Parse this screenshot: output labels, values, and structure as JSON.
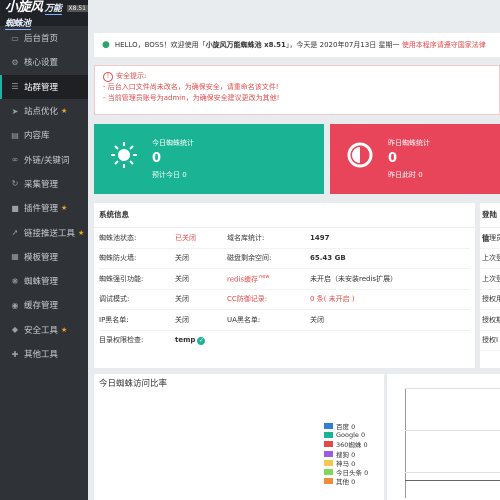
{
  "app": {
    "logo_main": "小旋风",
    "logo_sub": "万能蜘蛛池",
    "version": "X8.51"
  },
  "sidebar": {
    "items": [
      {
        "label": "后台首页",
        "icon": "monitor-icon",
        "pinned": false,
        "active": false
      },
      {
        "label": "核心设置",
        "icon": "gear-icon",
        "pinned": false,
        "active": false
      },
      {
        "label": "站群管理",
        "icon": "bars-icon",
        "pinned": false,
        "active": true
      },
      {
        "label": "站点优化",
        "icon": "rocket-icon",
        "pinned": true,
        "active": false
      },
      {
        "label": "内容库",
        "icon": "book-icon",
        "pinned": false,
        "active": false
      },
      {
        "label": "外链/关键词",
        "icon": "link-icon",
        "pinned": false,
        "active": false
      },
      {
        "label": "采集管理",
        "icon": "refresh-icon",
        "pinned": false,
        "active": false
      },
      {
        "label": "插件管理",
        "icon": "plugin-icon",
        "pinned": true,
        "active": false
      },
      {
        "label": "链接推送工具",
        "icon": "push-icon",
        "pinned": true,
        "active": false
      },
      {
        "label": "模板管理",
        "icon": "template-icon",
        "pinned": false,
        "active": false
      },
      {
        "label": "蜘蛛管理",
        "icon": "bug-icon",
        "pinned": false,
        "active": false
      },
      {
        "label": "缓存管理",
        "icon": "database-icon",
        "pinned": false,
        "active": false
      },
      {
        "label": "安全工具",
        "icon": "shield-icon",
        "pinned": true,
        "active": false
      },
      {
        "label": "其他工具",
        "icon": "cross-icon",
        "pinned": false,
        "active": false
      }
    ]
  },
  "notice": {
    "greeting": "HELLO，BOSS！欢迎使用「",
    "product": "小旋风万能蜘蛛池 x8.51",
    "date_text": "」，今天是 2020年07月13日 星期一",
    "warning": "使用本程序请遵守国家法律"
  },
  "alert": {
    "title": "安全提示:",
    "lines": [
      "- 后台入口文件尚未改名，为确保安全，请重命名该文件!",
      "- 当前管理员账号为admin，为确保安全建议更改为其他!"
    ]
  },
  "cards": {
    "today": {
      "title": "今日蜘蛛统计",
      "value": "0",
      "sub": "预计今日 0"
    },
    "yesterday": {
      "title": "昨日蜘蛛统计",
      "value": "0",
      "sub": "昨日此时 0"
    }
  },
  "sysinfo": {
    "title": "系统信息",
    "rows": [
      {
        "l1": "蜘蛛池状态:",
        "v1": "已关闭",
        "l2": "域名库统计:",
        "v2": "1497"
      },
      {
        "l1": "蜘蛛防火墙:",
        "v1": "关闭",
        "l2": "磁盘剩余空间:",
        "v2": "65.43 GB"
      },
      {
        "l1": "蜘蛛强引功能:",
        "v1": "关闭",
        "l2": "redis缓存",
        "tag": "new",
        "v2": "未开启（未安装redis扩展）"
      },
      {
        "l1": "调试模式:",
        "v1": "关闭",
        "l2": "CC防御记录:",
        "v2": "0 条( 未开启 )"
      },
      {
        "l1": "IP黑名单:",
        "v1": "关闭",
        "l2": "UA黑名单:",
        "v2": "关闭"
      },
      {
        "l1": "目录权限检查:",
        "v1": "temp",
        "l2": "",
        "v2": ""
      }
    ]
  },
  "login": {
    "title": "登陆信",
    "rows": [
      "管理员",
      "上次登",
      "上次登",
      "授权用",
      "授权期",
      "授权I"
    ]
  },
  "chart1": {
    "title": "今日蜘蛛访问比率",
    "legend": [
      {
        "name": "百度 0",
        "color": "#2f7ed8"
      },
      {
        "name": "Google 0",
        "color": "#1ab394"
      },
      {
        "name": "360蜘蛛 0",
        "color": "#e24a4a"
      },
      {
        "name": "搜狗 0",
        "color": "#9c5ce0"
      },
      {
        "name": "神马 0",
        "color": "#f2c94c"
      },
      {
        "name": "今日头条 0",
        "color": "#7ed957"
      },
      {
        "name": "其他 0",
        "color": "#f08c3a"
      }
    ]
  }
}
